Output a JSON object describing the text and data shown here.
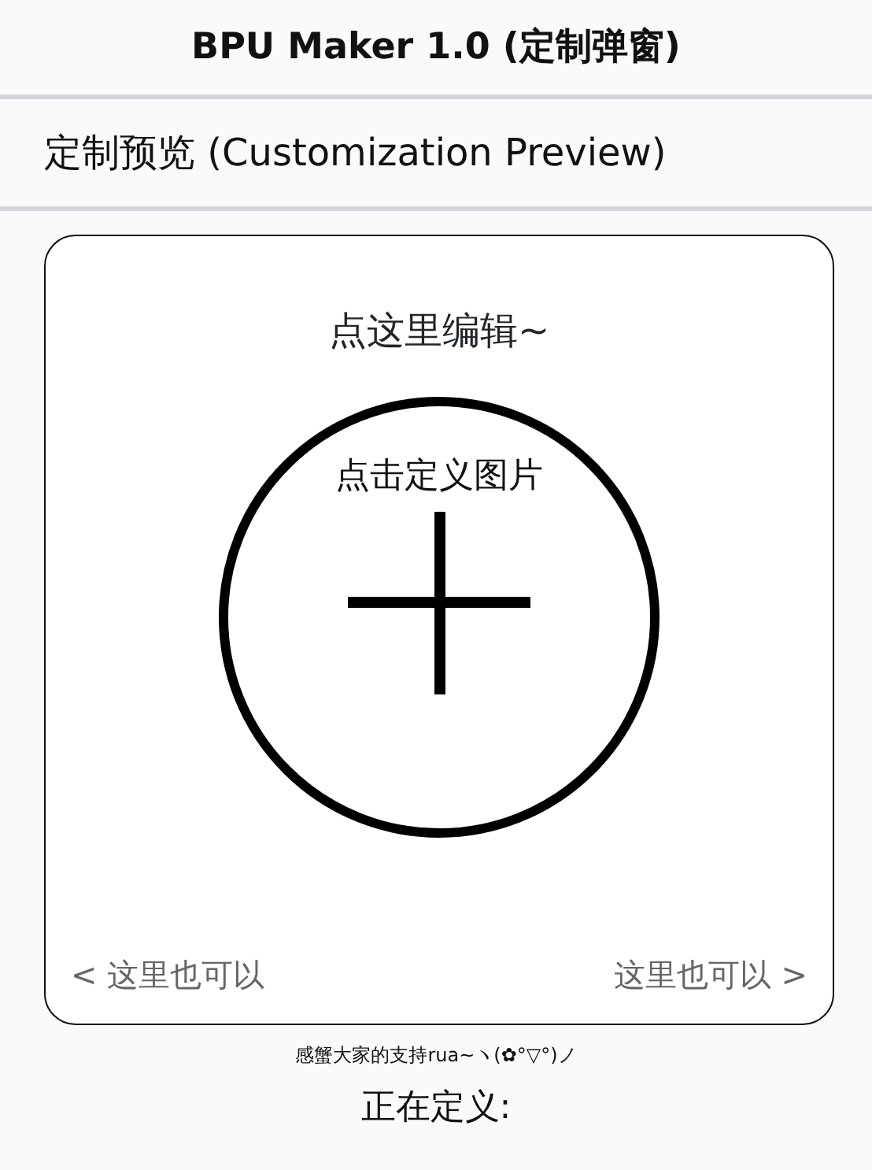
{
  "window": {
    "title": "BPU Maker 1.0 (定制弹窗)"
  },
  "section": {
    "title": "定制预览 (Customization Preview)"
  },
  "preview": {
    "edit_text": "点这里编辑~",
    "image_label": "点击定义图片",
    "left_link": "< 这里也可以",
    "right_link": "这里也可以 >"
  },
  "thanks": "感蟹大家的支持rua~ヽ(✿°▽°)ノ",
  "status": "正在定义:"
}
